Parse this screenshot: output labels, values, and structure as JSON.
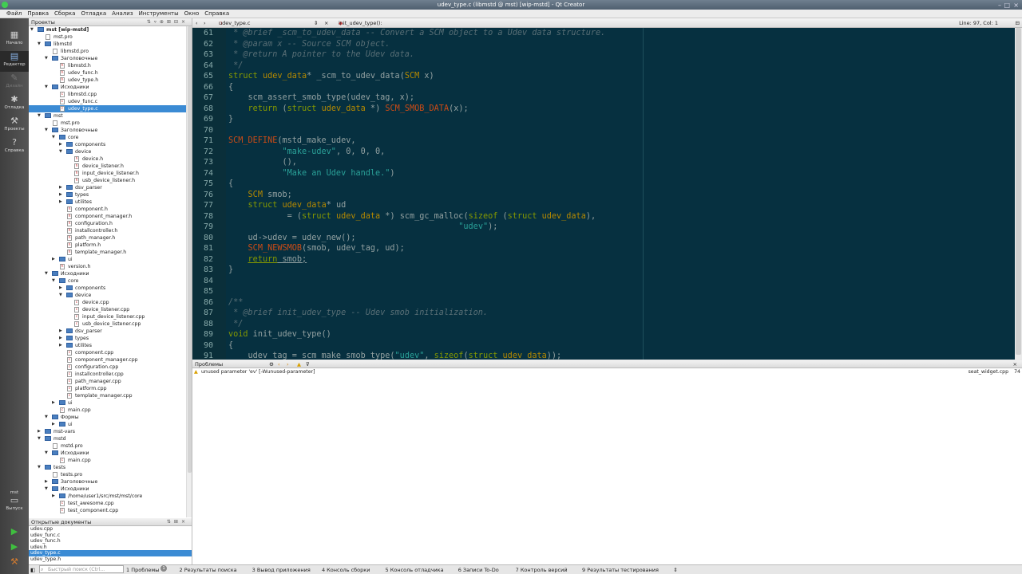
{
  "window": {
    "title": "udev_type.c (libmstd @ mst) [wip-mstd] - Qt Creator"
  },
  "menu": [
    "Файл",
    "Правка",
    "Сборка",
    "Отладка",
    "Анализ",
    "Инструменты",
    "Окно",
    "Справка"
  ],
  "modes": [
    {
      "label": "Начало",
      "icon": "grid-icon"
    },
    {
      "label": "Редактор",
      "icon": "edit-icon"
    },
    {
      "label": "Дизайн",
      "icon": "design-icon"
    },
    {
      "label": "Отладка",
      "icon": "bug-icon"
    },
    {
      "label": "Проекты",
      "icon": "wrench-icon"
    },
    {
      "label": "Справка",
      "icon": "help-icon"
    }
  ],
  "kit": {
    "name": "mst",
    "label": "Выпуск"
  },
  "projects_panel": {
    "title": "Проекты"
  },
  "tree": [
    {
      "d": 0,
      "t": "p",
      "a": "v",
      "l": "mst [wip-mstd]",
      "b": true
    },
    {
      "d": 1,
      "t": "f",
      "l": "mst.pro"
    },
    {
      "d": 1,
      "t": "d",
      "a": "v",
      "l": "libmstd"
    },
    {
      "d": 2,
      "t": "f",
      "l": "libmstd.pro"
    },
    {
      "d": 2,
      "t": "d",
      "a": "v",
      "l": "Заголовочные"
    },
    {
      "d": 3,
      "t": "f",
      "l": "libmstd.h"
    },
    {
      "d": 3,
      "t": "f",
      "l": "udev_func.h"
    },
    {
      "d": 3,
      "t": "f",
      "l": "udev_type.h"
    },
    {
      "d": 2,
      "t": "d",
      "a": "v",
      "l": "Исходники"
    },
    {
      "d": 3,
      "t": "f",
      "l": "libmstd.cpp"
    },
    {
      "d": 3,
      "t": "f",
      "l": "udev_func.c"
    },
    {
      "d": 3,
      "t": "f",
      "l": "udev_type.c",
      "sel": true
    },
    {
      "d": 1,
      "t": "d",
      "a": "v",
      "l": "mst"
    },
    {
      "d": 2,
      "t": "f",
      "l": "mst.pro"
    },
    {
      "d": 2,
      "t": "d",
      "a": "v",
      "l": "Заголовочные"
    },
    {
      "d": 3,
      "t": "d",
      "a": "v",
      "l": "core"
    },
    {
      "d": 4,
      "t": "d",
      "a": ">",
      "l": "components"
    },
    {
      "d": 4,
      "t": "d",
      "a": "v",
      "l": "device"
    },
    {
      "d": 5,
      "t": "f",
      "l": "device.h"
    },
    {
      "d": 5,
      "t": "f",
      "l": "device_listener.h"
    },
    {
      "d": 5,
      "t": "f",
      "l": "input_device_listener.h"
    },
    {
      "d": 5,
      "t": "f",
      "l": "usb_device_listener.h"
    },
    {
      "d": 4,
      "t": "d",
      "a": ">",
      "l": "dsv_parser"
    },
    {
      "d": 4,
      "t": "d",
      "a": ">",
      "l": "types"
    },
    {
      "d": 4,
      "t": "d",
      "a": ">",
      "l": "utilites"
    },
    {
      "d": 4,
      "t": "f",
      "l": "component.h"
    },
    {
      "d": 4,
      "t": "f",
      "l": "component_manager.h"
    },
    {
      "d": 4,
      "t": "f",
      "l": "configuration.h"
    },
    {
      "d": 4,
      "t": "f",
      "l": "installcontroller.h"
    },
    {
      "d": 4,
      "t": "f",
      "l": "path_manager.h"
    },
    {
      "d": 4,
      "t": "f",
      "l": "platform.h"
    },
    {
      "d": 4,
      "t": "f",
      "l": "template_manager.h"
    },
    {
      "d": 3,
      "t": "d",
      "a": ">",
      "l": "ui"
    },
    {
      "d": 3,
      "t": "f",
      "l": "version.h"
    },
    {
      "d": 2,
      "t": "d",
      "a": "v",
      "l": "Исходники"
    },
    {
      "d": 3,
      "t": "d",
      "a": "v",
      "l": "core"
    },
    {
      "d": 4,
      "t": "d",
      "a": ">",
      "l": "components"
    },
    {
      "d": 4,
      "t": "d",
      "a": "v",
      "l": "device"
    },
    {
      "d": 5,
      "t": "f",
      "l": "device.cpp"
    },
    {
      "d": 5,
      "t": "f",
      "l": "device_listener.cpp"
    },
    {
      "d": 5,
      "t": "f",
      "l": "input_device_listener.cpp"
    },
    {
      "d": 5,
      "t": "f",
      "l": "usb_device_listener.cpp"
    },
    {
      "d": 4,
      "t": "d",
      "a": ">",
      "l": "dsv_parser"
    },
    {
      "d": 4,
      "t": "d",
      "a": ">",
      "l": "types"
    },
    {
      "d": 4,
      "t": "d",
      "a": ">",
      "l": "utilites"
    },
    {
      "d": 4,
      "t": "f",
      "l": "component.cpp"
    },
    {
      "d": 4,
      "t": "f",
      "l": "component_manager.cpp"
    },
    {
      "d": 4,
      "t": "f",
      "l": "configuration.cpp"
    },
    {
      "d": 4,
      "t": "f",
      "l": "installcontroller.cpp"
    },
    {
      "d": 4,
      "t": "f",
      "l": "path_manager.cpp"
    },
    {
      "d": 4,
      "t": "f",
      "l": "platform.cpp"
    },
    {
      "d": 4,
      "t": "f",
      "l": "template_manager.cpp"
    },
    {
      "d": 3,
      "t": "d",
      "a": ">",
      "l": "ui"
    },
    {
      "d": 3,
      "t": "f",
      "l": "main.cpp"
    },
    {
      "d": 2,
      "t": "d",
      "a": "v",
      "l": "Формы"
    },
    {
      "d": 3,
      "t": "d",
      "a": ">",
      "l": "ui"
    },
    {
      "d": 1,
      "t": "d",
      "a": ">",
      "l": "mst-vars"
    },
    {
      "d": 1,
      "t": "d",
      "a": "v",
      "l": "mstd"
    },
    {
      "d": 2,
      "t": "f",
      "l": "mstd.pro"
    },
    {
      "d": 2,
      "t": "d",
      "a": "v",
      "l": "Исходники"
    },
    {
      "d": 3,
      "t": "f",
      "l": "main.cpp"
    },
    {
      "d": 1,
      "t": "d",
      "a": "v",
      "l": "tests"
    },
    {
      "d": 2,
      "t": "f",
      "l": "tests.pro"
    },
    {
      "d": 2,
      "t": "d",
      "a": ">",
      "l": "Заголовочные"
    },
    {
      "d": 2,
      "t": "d",
      "a": "v",
      "l": "Исходники"
    },
    {
      "d": 3,
      "t": "d",
      "a": ">",
      "l": "/home/user1/src/mst/mst/core"
    },
    {
      "d": 3,
      "t": "f",
      "l": "test_awesome.cpp"
    },
    {
      "d": 3,
      "t": "f",
      "l": "test_component.cpp"
    }
  ],
  "open_docs": {
    "title": "Открытые документы",
    "items": [
      "udev.cpp",
      "udev_func.c",
      "udev_func.h",
      "udev.h",
      "udev_type.c",
      "udev_type.h"
    ],
    "selected": 4
  },
  "editor": {
    "file_tab": "udev_type.c",
    "symbol": "init_udev_type(): void",
    "position": "Line: 97, Col: 1",
    "lines": [
      {
        "n": "61",
        "tokens": [
          [
            "cm",
            " * @brief _scm_to_udev_data -- Convert a SCM object to a Udev data structure."
          ]
        ]
      },
      {
        "n": "62",
        "tokens": [
          [
            "cm",
            " * @param x -- Source SCM object."
          ]
        ]
      },
      {
        "n": "63",
        "tokens": [
          [
            "cm",
            " * @return A pointer to the Udev data."
          ]
        ]
      },
      {
        "n": "64",
        "tokens": [
          [
            "cm",
            " */"
          ]
        ]
      },
      {
        "n": "65",
        "tokens": [
          [
            "kw",
            "struct"
          ],
          [
            "",
            ""
          ],
          [
            "",
            " "
          ],
          [
            "ty",
            "udev_data"
          ],
          [
            "",
            "* _scm_to_udev_data("
          ],
          [
            "ty",
            "SCM"
          ],
          [
            "",
            " x)"
          ]
        ]
      },
      {
        "n": "66",
        "tokens": [
          [
            "",
            "{"
          ]
        ]
      },
      {
        "n": "67",
        "tokens": [
          [
            "",
            "    scm_assert_smob_type(udev_tag, x);"
          ]
        ]
      },
      {
        "n": "68",
        "tokens": [
          [
            "",
            "    "
          ],
          [
            "kw",
            "return"
          ],
          [
            "",
            " ("
          ],
          [
            "kw",
            "struct"
          ],
          [
            "",
            " "
          ],
          [
            "ty",
            "udev_data"
          ],
          [
            "",
            " *) "
          ],
          [
            "mc",
            "SCM_SMOB_DATA"
          ],
          [
            "",
            "(x);"
          ]
        ]
      },
      {
        "n": "69",
        "tokens": [
          [
            "",
            "}"
          ]
        ]
      },
      {
        "n": "70",
        "tokens": [
          [
            "",
            ""
          ]
        ]
      },
      {
        "n": "71",
        "tokens": [
          [
            "mc",
            "SCM_DEFINE"
          ],
          [
            "",
            "(mstd_make_udev,"
          ]
        ]
      },
      {
        "n": "72",
        "tokens": [
          [
            "",
            "           "
          ],
          [
            "st",
            "\"make-udev\""
          ],
          [
            "",
            ", 0, 0, 0,"
          ]
        ]
      },
      {
        "n": "73",
        "tokens": [
          [
            "",
            "           (),"
          ]
        ]
      },
      {
        "n": "74",
        "tokens": [
          [
            "",
            "           "
          ],
          [
            "st",
            "\"Make an Udev handle.\""
          ],
          [
            "",
            ")"
          ]
        ]
      },
      {
        "n": "75",
        "tokens": [
          [
            "",
            "{"
          ]
        ]
      },
      {
        "n": "76",
        "tokens": [
          [
            "",
            "    "
          ],
          [
            "ty",
            "SCM"
          ],
          [
            "",
            " smob;"
          ]
        ]
      },
      {
        "n": "77",
        "tokens": [
          [
            "",
            "    "
          ],
          [
            "kw",
            "struct"
          ],
          [
            "",
            " "
          ],
          [
            "ty",
            "udev_data"
          ],
          [
            "",
            "* ud"
          ]
        ]
      },
      {
        "n": "78",
        "tokens": [
          [
            "",
            "            = ("
          ],
          [
            "kw",
            "struct"
          ],
          [
            "",
            " "
          ],
          [
            "ty",
            "udev_data"
          ],
          [
            "",
            " *) scm_gc_malloc("
          ],
          [
            "kw",
            "sizeof"
          ],
          [
            "",
            " ("
          ],
          [
            "kw",
            "struct"
          ],
          [
            "",
            " "
          ],
          [
            "ty",
            "udev_data"
          ],
          [
            "",
            "),"
          ]
        ]
      },
      {
        "n": "79",
        "tokens": [
          [
            "",
            "                                               "
          ],
          [
            "st",
            "\"udev\""
          ],
          [
            "",
            ");"
          ]
        ]
      },
      {
        "n": "80",
        "tokens": [
          [
            "",
            "    ud->udev = udev_new();"
          ]
        ]
      },
      {
        "n": "81",
        "tokens": [
          [
            "",
            "    "
          ],
          [
            "mc",
            "SCM_NEWSMOB"
          ],
          [
            "",
            "(smob, udev_tag, ud);"
          ]
        ]
      },
      {
        "n": "82",
        "tokens": [
          [
            "",
            "    "
          ],
          [
            "kwu",
            "return"
          ],
          [
            "un",
            " smob;"
          ]
        ]
      },
      {
        "n": "83",
        "tokens": [
          [
            "",
            "}"
          ]
        ]
      },
      {
        "n": "84",
        "tokens": [
          [
            "",
            ""
          ]
        ]
      },
      {
        "n": "85",
        "tokens": [
          [
            "",
            ""
          ]
        ]
      },
      {
        "n": "86",
        "tokens": [
          [
            "cm",
            "/**"
          ]
        ]
      },
      {
        "n": "87",
        "tokens": [
          [
            "cm",
            " * @brief init_udev_type -- Udev smob initialization."
          ]
        ]
      },
      {
        "n": "88",
        "tokens": [
          [
            "cm",
            " */"
          ]
        ]
      },
      {
        "n": "89",
        "tokens": [
          [
            "kw",
            "void"
          ],
          [
            "",
            " init_udev_type()"
          ]
        ]
      },
      {
        "n": "90",
        "tokens": [
          [
            "",
            "{"
          ]
        ]
      },
      {
        "n": "91",
        "tokens": [
          [
            "",
            "    udev_tag = scm_make_smob_type("
          ],
          [
            "st",
            "\"udev\""
          ],
          [
            "",
            ", "
          ],
          [
            "kw",
            "sizeof"
          ],
          [
            "",
            "("
          ],
          [
            "kw",
            "struct"
          ],
          [
            "",
            " "
          ],
          [
            "ty",
            "udev_data"
          ],
          [
            "",
            "));"
          ]
        ]
      }
    ]
  },
  "problems": {
    "title": "Проблемы",
    "items": [
      {
        "text": "unused parameter 'ev' [-Wunused-parameter]",
        "file": "seat_widget.cpp",
        "line": "74"
      }
    ]
  },
  "statusbar": {
    "search_placeholder": "Быстрый поиск (Ctrl...",
    "tabs": [
      {
        "n": "1",
        "label": "Проблемы",
        "badge": "1"
      },
      {
        "n": "2",
        "label": "Результаты поиска"
      },
      {
        "n": "3",
        "label": "Вывод приложения"
      },
      {
        "n": "4",
        "label": "Консоль сборки"
      },
      {
        "n": "5",
        "label": "Консоль отладчика"
      },
      {
        "n": "6",
        "label": "Записи To-Do"
      },
      {
        "n": "7",
        "label": "Контроль версий"
      },
      {
        "n": "9",
        "label": "Результаты тестирования"
      }
    ]
  }
}
